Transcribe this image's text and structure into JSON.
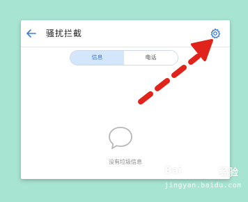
{
  "header": {
    "title": "骚扰拦截",
    "back_icon": "arrow-left-icon",
    "settings_icon": "gear-icon"
  },
  "tabs": [
    {
      "label": "信息",
      "active": true
    },
    {
      "label": "电话",
      "active": false
    }
  ],
  "empty_state": {
    "icon": "speech-bubble-icon",
    "text": "没有垃圾信息"
  },
  "annotation": {
    "type": "dashed-arrow",
    "color": "#e0241b"
  },
  "watermark": {
    "brand": "Bai",
    "brand2": "经验",
    "url": "jingyan.baidu.com"
  },
  "colors": {
    "background": "#a8e4d2",
    "accent": "#3b7cd8",
    "tab_active_bg": "#d3e6fb",
    "arrow": "#e0241b"
  }
}
